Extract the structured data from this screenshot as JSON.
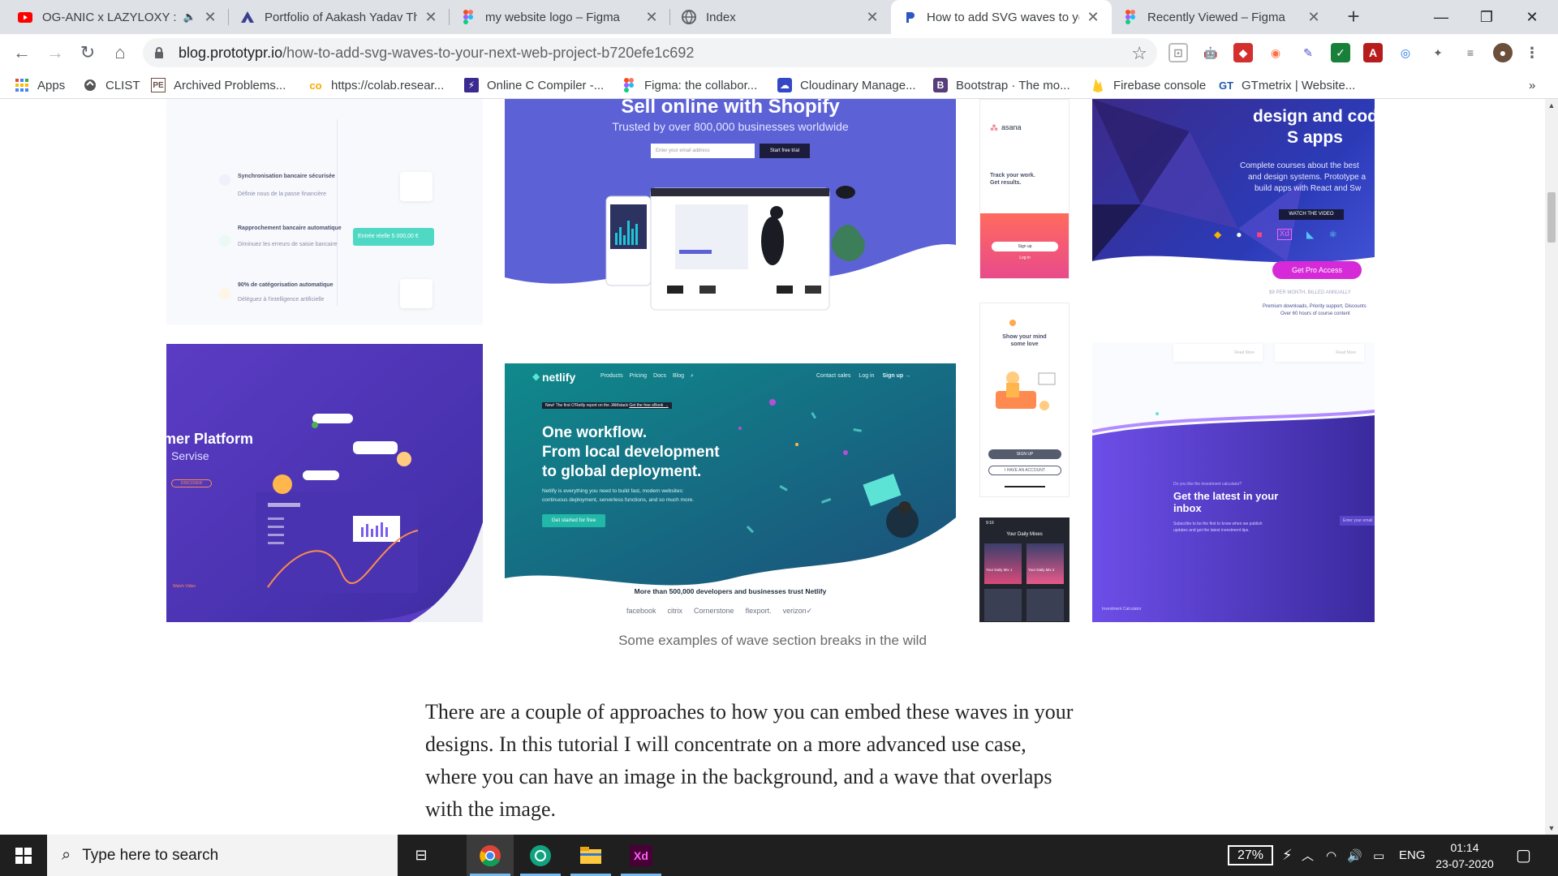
{
  "tabs": [
    {
      "title": "OG-ANIC x LAZYLOXY : t",
      "favicon": "youtube-icon",
      "muted_icon": "speaker-icon"
    },
    {
      "title": "Portfolio of Aakash Yadav The",
      "favicon": "site-logo-icon"
    },
    {
      "title": "my website logo – Figma",
      "favicon": "figma-icon"
    },
    {
      "title": "Index",
      "favicon": "globe-icon"
    },
    {
      "title": "How to add SVG waves to yo",
      "favicon": "prototypr-icon"
    },
    {
      "title": "Recently Viewed – Figma",
      "favicon": "figma-icon"
    }
  ],
  "address": {
    "host": "blog.prototypr.io",
    "path": "/how-to-add-svg-waves-to-your-next-web-project-b720efe1c692"
  },
  "bookmarks": [
    {
      "label": "Apps",
      "icon": "apps-grid-icon"
    },
    {
      "label": "CLIST",
      "icon": "clist-icon"
    },
    {
      "label": "Archived Problems...",
      "icon": "pe-icon"
    },
    {
      "label": "https://colab.resear...",
      "icon": "colab-icon"
    },
    {
      "label": "Online C Compiler -...",
      "icon": "bolt-icon"
    },
    {
      "label": "Figma: the collabor...",
      "icon": "figma-icon"
    },
    {
      "label": "Cloudinary Manage...",
      "icon": "cloudinary-icon"
    },
    {
      "label": "Bootstrap · The mo...",
      "icon": "bootstrap-icon"
    },
    {
      "label": "Firebase console",
      "icon": "firebase-icon"
    },
    {
      "label": "GTmetrix | Website...",
      "icon": "gtmetrix-icon"
    }
  ],
  "extensions_overflow": "»",
  "gallery": {
    "caption": "Some examples of wave section breaks in the wild",
    "shot1": {
      "items": [
        {
          "title": "Synchronisation bancaire sécurisée",
          "sub": "Définie nous de la passe financière"
        },
        {
          "title": "Rapprochement bancaire automatique",
          "sub": "Diminuez les erreurs de saisie bancaire"
        },
        {
          "title": "90% de catégorisation automatique",
          "sub": "Déléguez à l'intelligence artificielle"
        }
      ],
      "pill": "Entrée réelle   5 000,00 €"
    },
    "shopify": {
      "headline": "Sell online with Shopify",
      "sub": "Trusted by over 800,000 businesses worldwide",
      "email_placeholder": "Enter your email address",
      "cta": "Start free trial"
    },
    "asana": {
      "brand": "asana",
      "tagline1": "Track your work.",
      "tagline2": "Get results.",
      "signup": "Sign up",
      "login": "Log in"
    },
    "pro": {
      "headline1": "design and cod",
      "headline2": "S apps",
      "sub1": "Complete courses about the best",
      "sub2": "and design systems. Prototype a",
      "sub3": "build apps with React and Sw",
      "watch": "WATCH THE VIDEO",
      "cta": "Get Pro Access",
      "price": "$9 PER MONTH, BILLED ANNUALLY",
      "note1": "Premium downloads, Priority support, Discounts",
      "note2": "Over 60 hours of course content"
    },
    "platform": {
      "title": "mer Platform",
      "sub": "Servise",
      "cta": "DISCOVER",
      "footer": "Watch Video"
    },
    "netlify": {
      "brand": "netlify",
      "nav": [
        "Products",
        "Pricing",
        "Docs",
        "Blog"
      ],
      "nav_right": [
        "Contact sales",
        "Log in",
        "Sign up →"
      ],
      "badge": "New! The first O'Reilly report on the JAMstack",
      "badge_link": "Get the free eBook →",
      "headline1": "One workflow.",
      "headline2": "From local development",
      "headline3": "to global deployment.",
      "body1": "Netlify is everything you need to build fast, modern websites:",
      "body2": "continuous deployment, serverless functions, and so much more.",
      "cta": "Get started for free",
      "trust": "More than 500,000 developers and businesses trust Netlify",
      "logos": [
        "facebook",
        "citrix",
        "Cornerstone",
        "flexport.",
        "verizon✓"
      ]
    },
    "mindlove": {
      "title1": "Show your mind",
      "title2": "some love",
      "btn1": "SIGN UP",
      "btn2": "I HAVE AN ACCOUNT"
    },
    "music": {
      "title": "Your Daily Mixes",
      "mix1": "Your Daily Mix 1",
      "mix2": "Your Daily Mix 2",
      "time": "9:16"
    },
    "newsletter": {
      "read_more": "Read More",
      "question": "Do you like the investment calculator?",
      "headline1": "Get the latest in your",
      "headline2": "inbox",
      "body1": "Subscribe to be the first to know when we publish",
      "body2": "updates and get the latest investment tips.",
      "email": "Enter your email",
      "footer": "Investment Calculator"
    }
  },
  "article": {
    "paragraph": "There are a couple of approaches to how you can embed these waves in your designs. In this tutorial I will concentrate on a more advanced use case, where you can have an image in the background, and a wave that overlaps with the image."
  },
  "taskbar": {
    "search_placeholder": "Type here to search",
    "battery": "27%",
    "language": "ENG",
    "time": "01:14",
    "date": "23-07-2020",
    "apps": [
      "task-view-icon",
      "chrome-icon",
      "chatgpt-icon",
      "file-explorer-icon",
      "adobe-xd-icon"
    ]
  },
  "colors": {
    "tabstrip": "#dee1e6",
    "shopify_purple": "#5c62d6",
    "netlify_teal": "#0f8a8c",
    "taskbar": "#1f1f1f"
  }
}
